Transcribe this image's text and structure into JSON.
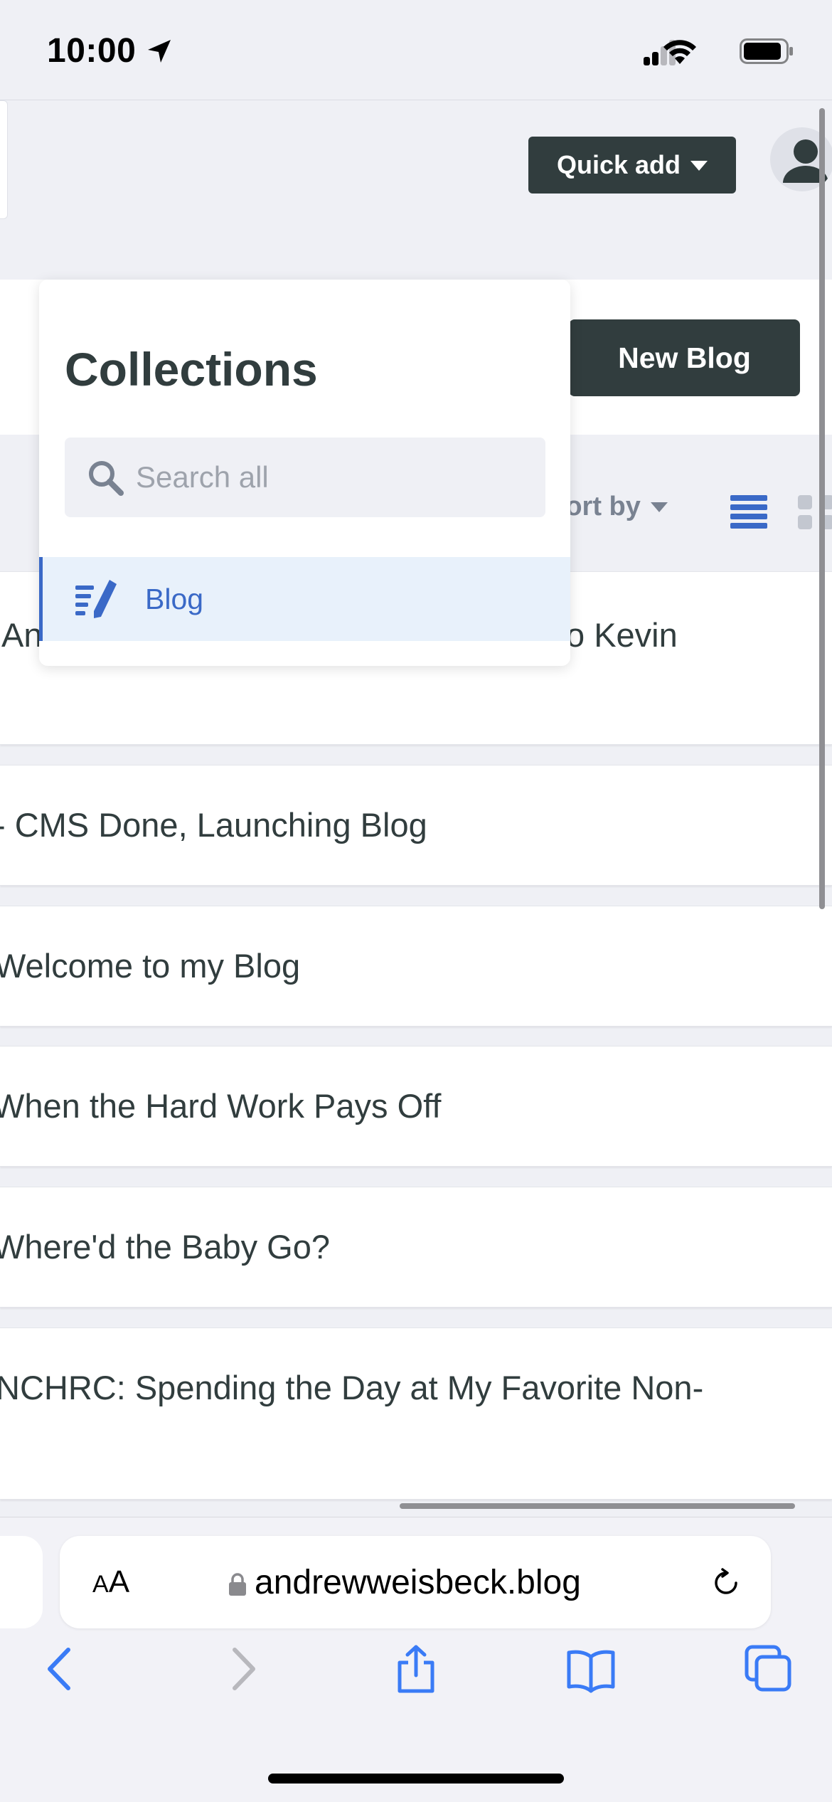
{
  "status_bar": {
    "time": "10:00"
  },
  "header": {
    "quick_add_label": "Quick add"
  },
  "toolbar": {
    "new_button_label": "New Blog",
    "sort_label": "Sort by"
  },
  "collections_dropdown": {
    "heading": "Collections",
    "search_placeholder": "Search all",
    "items": [
      {
        "label": "Blog",
        "icon": "blog-pen-icon",
        "selected": true
      }
    ]
  },
  "entries": [
    {
      "title": "An",
      "title_tail": "o Kevin"
    },
    {
      "title": "- CMS Done, Launching Blog"
    },
    {
      "title": "Welcome to my Blog"
    },
    {
      "title": "When the Hard Work Pays Off"
    },
    {
      "title": "Where'd the Baby Go?"
    },
    {
      "title": "NCHRC: Spending the Day at My Favorite Non-"
    }
  ],
  "browser": {
    "text_size_label_small": "A",
    "text_size_label_large": "A",
    "url": "andrewweisbeck.blog"
  },
  "colors": {
    "accent": "#3a69c7",
    "button_dark": "#313d3e",
    "page_bg": "#eff0f5"
  }
}
